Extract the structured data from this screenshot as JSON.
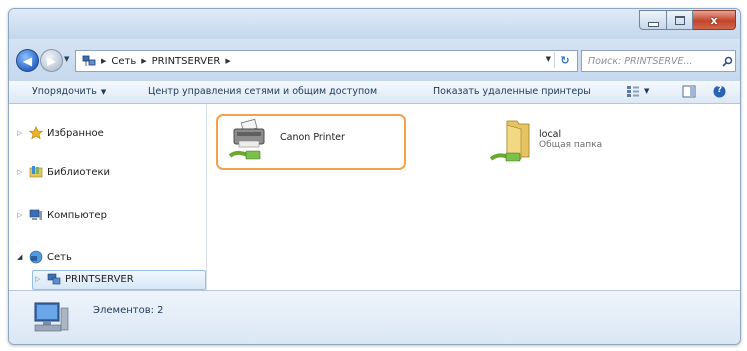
{
  "title_bar": {
    "buttons": [
      "minimize",
      "maximize",
      "close"
    ],
    "close_glyph": "x"
  },
  "nav_buttons": {
    "back_glyph": "◀",
    "forward_glyph": "▶"
  },
  "address": {
    "crumbs": [
      "Сеть",
      "PRINTSERVER"
    ],
    "refresh_glyph": "↻"
  },
  "search": {
    "placeholder": "Поиск: PRINTSERVE..."
  },
  "toolbar": {
    "organize": "Упорядочить",
    "network_center": "Центр управления сетями и общим доступом",
    "show_remote_printers": "Показать удаленные принтеры",
    "help_glyph": "?"
  },
  "sidebar": {
    "items": [
      {
        "label": "Избранное",
        "icon": "star-icon"
      },
      {
        "label": "Библиотеки",
        "icon": "library-icon"
      },
      {
        "label": "Компьютер",
        "icon": "computer-icon"
      },
      {
        "label": "Сеть",
        "icon": "network-icon"
      },
      {
        "label": "PRINTSERVER",
        "icon": "server-icon"
      }
    ]
  },
  "content": {
    "items": [
      {
        "name": "Canon Printer",
        "subtitle": "",
        "icon": "printer-icon"
      },
      {
        "name": "local",
        "subtitle": "Общая папка",
        "icon": "shared-folder-icon"
      }
    ]
  },
  "details": {
    "count_text": "Элементов: 2"
  },
  "colors": {
    "focus": "#f5a04a",
    "accent": "#2f74c7",
    "close": "#c2452b"
  }
}
